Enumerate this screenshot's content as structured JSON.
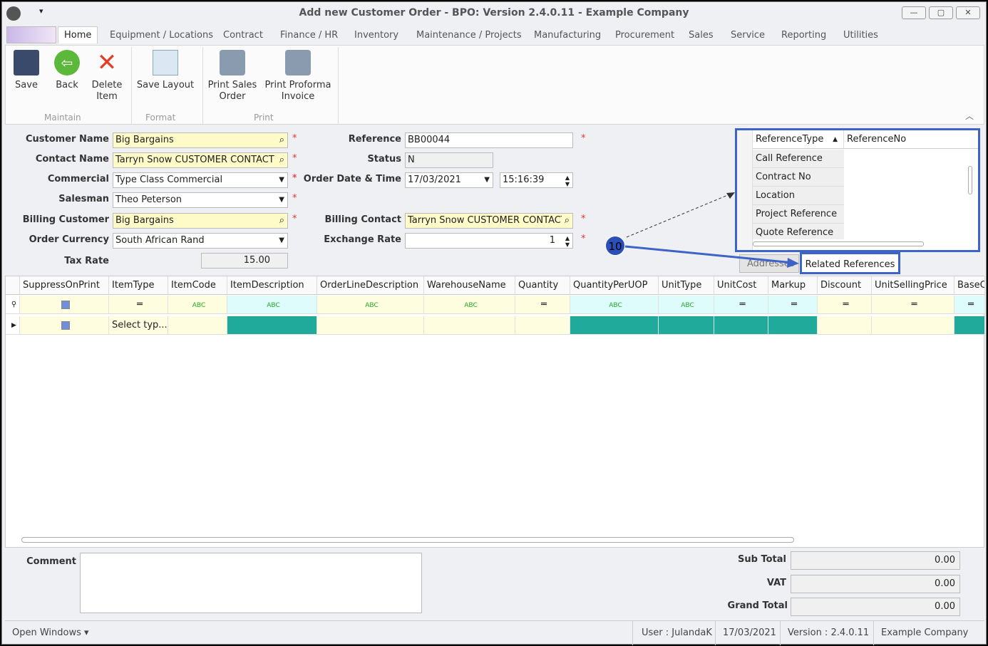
{
  "window": {
    "title": "Add new Customer Order - BPO: Version 2.4.0.11 - Example Company"
  },
  "tabs": [
    "Home",
    "Equipment / Locations",
    "Contract",
    "Finance / HR",
    "Inventory",
    "Maintenance / Projects",
    "Manufacturing",
    "Procurement",
    "Sales",
    "Service",
    "Reporting",
    "Utilities"
  ],
  "ribbon": {
    "buttons": [
      {
        "label": "Save",
        "icon": "save-icon"
      },
      {
        "label": "Back",
        "icon": "back-arrow-icon"
      },
      {
        "label": "Delete",
        "label2": "Item",
        "icon": "delete-x-icon"
      },
      {
        "label": "Save Layout",
        "icon": "layout-wrench-icon"
      },
      {
        "label": "Print Sales",
        "label2": "Order",
        "icon": "printer-icon"
      },
      {
        "label": "Print Proforma",
        "label2": "Invoice",
        "icon": "printer-icon"
      }
    ],
    "groups": [
      "Maintain",
      "Format",
      "Print"
    ]
  },
  "form": {
    "customer_name": {
      "label": "Customer Name",
      "value": "Big Bargains"
    },
    "contact_name": {
      "label": "Contact Name",
      "value": "Tarryn Snow CUSTOMER CONTACT"
    },
    "commercial": {
      "label": "Commercial",
      "value": "Type Class Commercial"
    },
    "salesman": {
      "label": "Salesman",
      "value": "Theo Peterson"
    },
    "billing_customer": {
      "label": "Billing Customer",
      "value": "Big Bargains"
    },
    "order_currency": {
      "label": "Order Currency",
      "value": "South African Rand"
    },
    "tax_rate": {
      "label": "Tax Rate",
      "value": "15.00"
    },
    "reference": {
      "label": "Reference",
      "value": "BB00044"
    },
    "status": {
      "label": "Status",
      "value": "N"
    },
    "order_date": {
      "label": "Order Date & Time",
      "date": "17/03/2021",
      "time": "15:16:39"
    },
    "billing_contact": {
      "label": "Billing Contact",
      "value": "Tarryn Snow CUSTOMER CONTACT"
    },
    "exchange_rate": {
      "label": "Exchange Rate",
      "value": "1"
    }
  },
  "references": {
    "columns": [
      "ReferenceType",
      "ReferenceNo"
    ],
    "rows": [
      "Call Reference",
      "Contract No",
      "Location",
      "Project Reference",
      "Quote Reference"
    ],
    "tabs": [
      "Addresses",
      "Related References"
    ]
  },
  "annotation": {
    "number": "10",
    "color": "#3355bb"
  },
  "grid": {
    "columns": [
      "SuppressOnPrint",
      "ItemType",
      "ItemCode",
      "ItemDescription",
      "OrderLineDescription",
      "WarehouseName",
      "Quantity",
      "QuantityPerUOP",
      "UnitType",
      "UnitCost",
      "Markup",
      "Discount",
      "UnitSellingPrice",
      "BaseC"
    ],
    "row_itemtype": "Select typ...",
    "highlight_color": "#20aa9c"
  },
  "totals": {
    "comment_label": "Comment",
    "sub_total": {
      "label": "Sub Total",
      "value": "0.00"
    },
    "vat": {
      "label": "VAT",
      "value": "0.00"
    },
    "grand_total": {
      "label": "Grand Total",
      "value": "0.00"
    }
  },
  "status": {
    "open_windows": "Open Windows ▾",
    "user": "User : JulandaK",
    "date": "17/03/2021",
    "version": "Version : 2.4.0.11",
    "company": "Example Company"
  }
}
